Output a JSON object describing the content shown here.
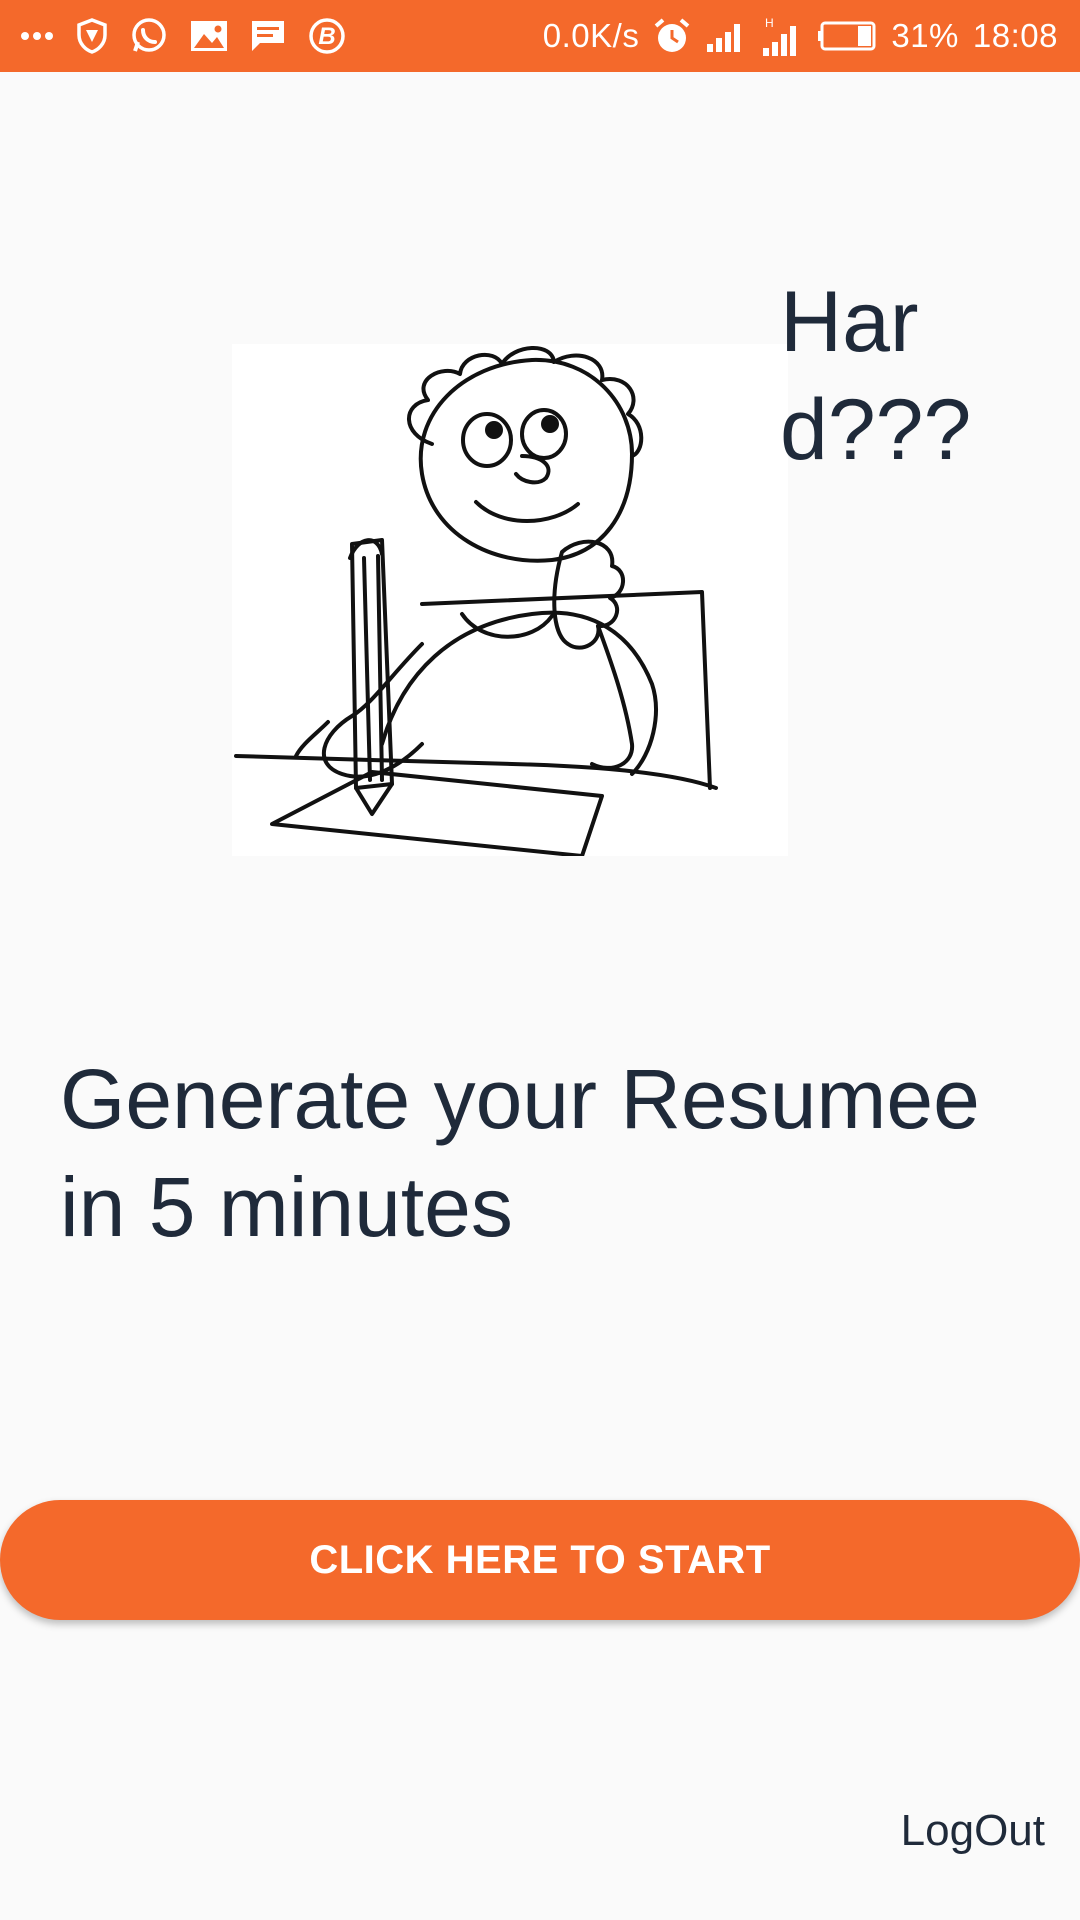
{
  "status_bar": {
    "network_speed": "0.0K/s",
    "battery_percent": "31%",
    "time": "18:08",
    "accent_color": "#f4692b",
    "left_icons": [
      "more-dots-icon",
      "vpn-shield-icon",
      "whatsapp-icon",
      "gallery-icon",
      "message-icon",
      "b-app-icon"
    ],
    "right_icons": [
      "alarm-icon",
      "signal-icon",
      "signal-h-icon",
      "battery-icon"
    ]
  },
  "hero": {
    "question_text": "Hard???",
    "illustration_icon": "thinking-boy-writing-illustration"
  },
  "headline": "Generate your Resumee in 5 minutes",
  "start_button_label": "CLICK HERE TO START",
  "logout_label": "LogOut"
}
